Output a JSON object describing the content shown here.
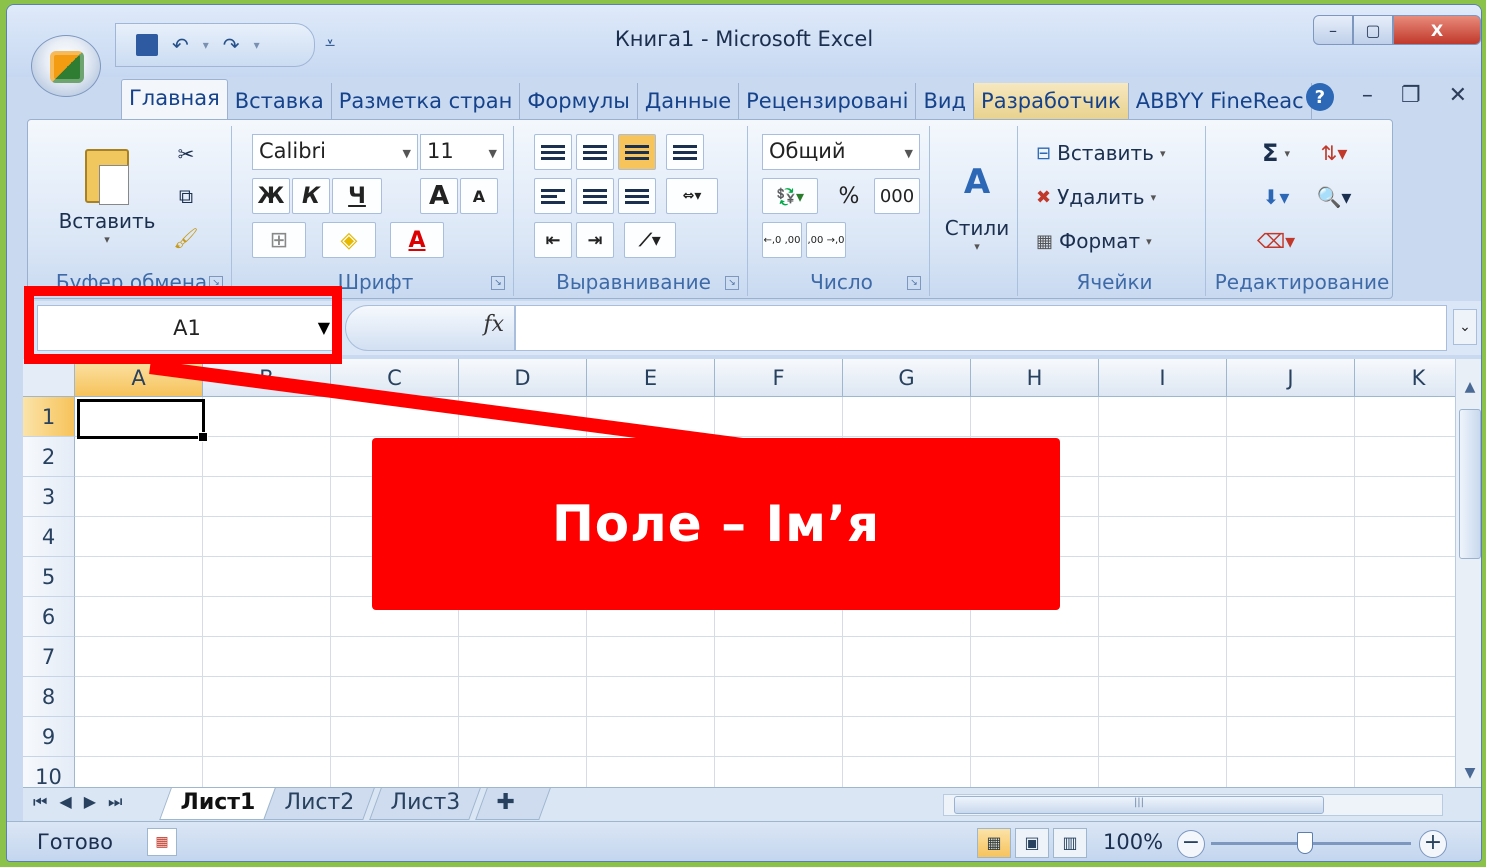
{
  "window": {
    "title": "Книга1  -  Microsoft Excel",
    "controls": {
      "minimize": "–",
      "maximize": "▢",
      "close": "X"
    }
  },
  "qat": {
    "save": "💾",
    "undo": "↶",
    "redo": "↷",
    "more": "⩡"
  },
  "tabs": [
    "Главная",
    "Вставка",
    "Разметка стран",
    "Формулы",
    "Данные",
    "Рецензировані",
    "Вид",
    "Разработчик",
    "ABBYY FineReac"
  ],
  "ribbon": {
    "clipboard": {
      "paste": "Вставить",
      "label": "Буфер обмена"
    },
    "font": {
      "name": "Calibri",
      "size": "11",
      "bold": "Ж",
      "italic": "К",
      "underline": "Ч",
      "grow": "A",
      "shrink": "A",
      "label": "Шрифт"
    },
    "alignment": {
      "label": "Выравнивание"
    },
    "number": {
      "format": "Общий",
      "percent": "%",
      "thousands": "000",
      "inc_dec": "←,0 ,00",
      "dec_dec": ",00 →,0",
      "label": "Число"
    },
    "styles": {
      "label": "Стили"
    },
    "cells": {
      "insert": "Вставить",
      "delete": "Удалить",
      "format": "Формат",
      "label": "Ячейки"
    },
    "editing": {
      "sum": "Σ",
      "label": "Редактирование"
    }
  },
  "formula_bar": {
    "name_box": "A1",
    "fx": "fx",
    "value": ""
  },
  "grid": {
    "columns": [
      "A",
      "B",
      "C",
      "D",
      "E",
      "F",
      "G",
      "H",
      "I",
      "J",
      "K"
    ],
    "rows": [
      "1",
      "2",
      "3",
      "4",
      "5",
      "6",
      "7",
      "8",
      "9",
      "10"
    ],
    "active_cell": "A1"
  },
  "sheets": [
    "Лист1",
    "Лист2",
    "Лист3"
  ],
  "status": {
    "text": "Готово",
    "zoom": "100%"
  },
  "annotation": {
    "label": "Поле – Ім’я"
  },
  "colors": {
    "highlight": "#ff0000",
    "selected_header": "#f7c35b"
  }
}
